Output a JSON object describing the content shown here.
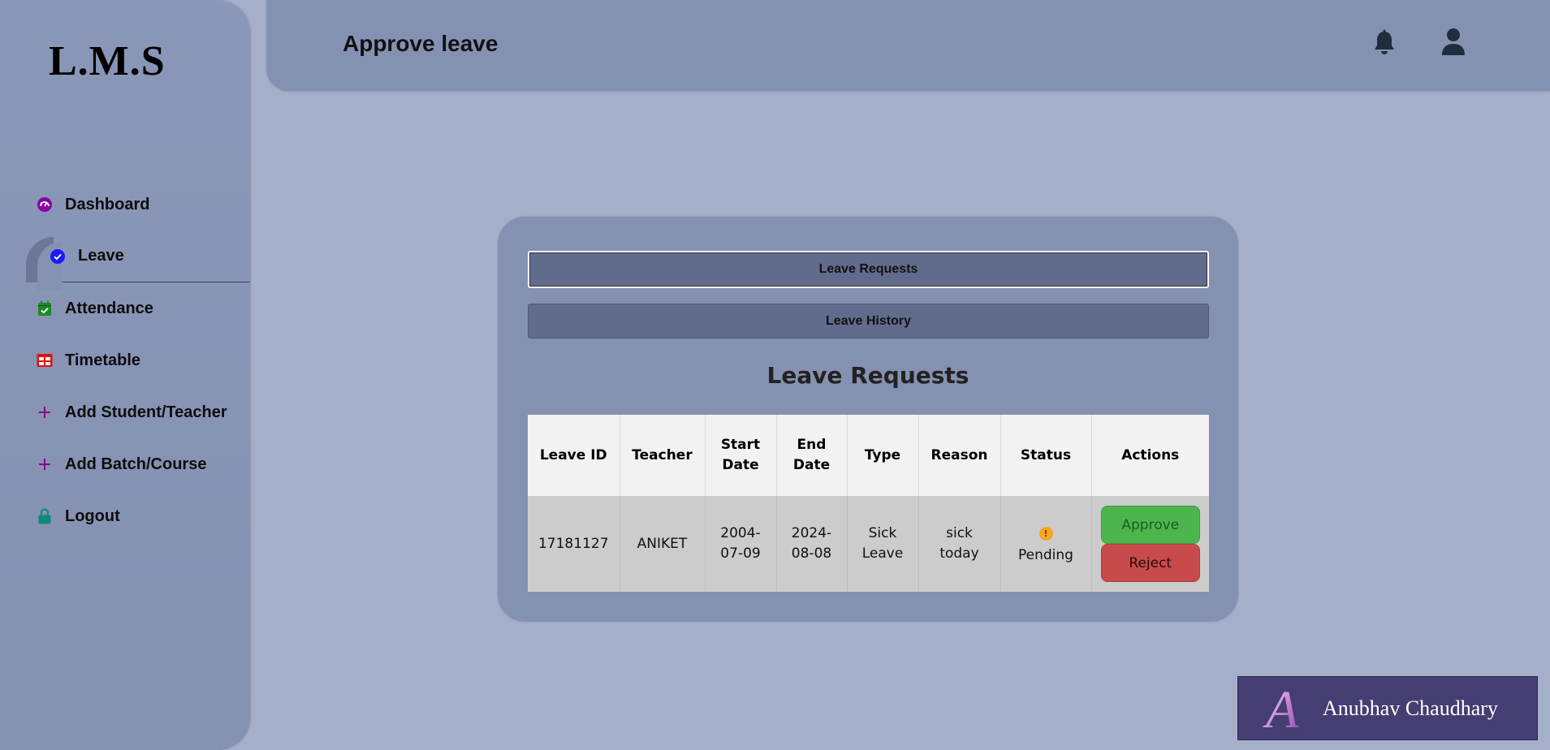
{
  "app": {
    "logo": "L.M.S"
  },
  "sidebar": {
    "items": [
      {
        "label": "Dashboard",
        "icon": "dashboard-icon",
        "color": "#8a00a0"
      },
      {
        "label": "Leave",
        "icon": "check-circle-icon",
        "color": "#1a1aff",
        "active": true
      },
      {
        "label": "Attendance",
        "icon": "calendar-check-icon",
        "color": "#1e8a2a"
      },
      {
        "label": "Timetable",
        "icon": "table-icon",
        "color": "#e01010"
      },
      {
        "label": "Add Student/Teacher",
        "icon": "plus-icon",
        "color": "#8a008a"
      },
      {
        "label": "Add Batch/Course",
        "icon": "plus-icon",
        "color": "#8a008a"
      },
      {
        "label": "Logout",
        "icon": "lock-icon",
        "color": "#0f8a7a"
      }
    ]
  },
  "header": {
    "title": "Approve leave",
    "icons": [
      "bell-icon",
      "user-icon"
    ]
  },
  "card": {
    "tabs": [
      "Leave Requests",
      "Leave History"
    ],
    "section_title": "Leave Requests",
    "table": {
      "headers": [
        "Leave ID",
        "Teacher",
        "Start Date",
        "End Date",
        "Type",
        "Reason",
        "Status",
        "Actions"
      ],
      "rows": [
        {
          "leave_id": "17181127",
          "teacher": "ANIKET",
          "start_date": "2004-07-09",
          "end_date": "2024-08-08",
          "type": "Sick Leave",
          "reason": "sick today",
          "status_icon": "!",
          "status": "Pending",
          "approve_label": "Approve",
          "reject_label": "Reject"
        }
      ]
    }
  },
  "watermark": {
    "initial": "A",
    "name": "Anubhav Chaudhary"
  },
  "colors": {
    "background": "#a5afca",
    "panel": "#8591b1",
    "tab_button": "#616b8c",
    "approve": "#4cb64c",
    "reject": "#c84b4b",
    "pending": "#f5a623"
  }
}
